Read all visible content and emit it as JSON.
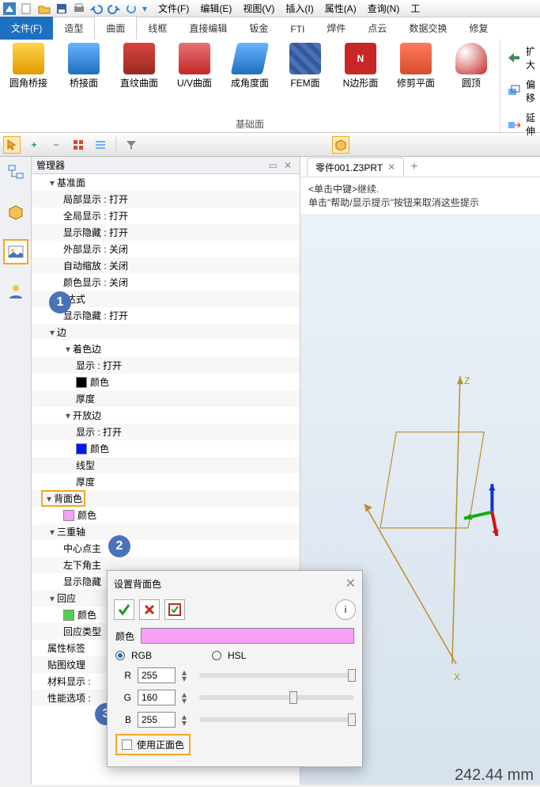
{
  "menus": {
    "file": "文件(F)",
    "edit": "编辑(E)",
    "view": "视图(V)",
    "insert": "插入(I)",
    "attr": "属性(A)",
    "query": "查询(N)",
    "tool": "工"
  },
  "ribbon": {
    "tabs": {
      "file": "文件(F)",
      "model": "造型",
      "curve": "曲面",
      "wire": "线框",
      "direct": "直接编辑",
      "sheet": "钣金",
      "fti": "FTI",
      "weld": "焊件",
      "pcloud": "点云",
      "dataex": "数据交换",
      "repair": "修复"
    },
    "items": {
      "yuanjiao": "圆角桥接",
      "qiaojie": "桥接面",
      "zhiwen": "直纹曲面",
      "uv": "U/V曲面",
      "chengjiao": "成角度面",
      "fem": "FEM面",
      "nbian": "N边形面",
      "xiujian": "修剪平面",
      "yuanding": "圆顶"
    },
    "group": "基础面",
    "right": {
      "expand": "扩大",
      "offset": "偏移",
      "extend": "延伸"
    }
  },
  "manager": {
    "title": "管理器",
    "nodes": {
      "jizhun": "基准面",
      "jubu": "局部显示 : 打开",
      "quanju": "全局显示 : 打开",
      "xsyin": "显示隐藏 : 打开",
      "waibu": "外部显示 : 关闭",
      "zdsf": "自动缩放 : 关闭",
      "ysxs": "颜色显示 : 关闭",
      "biaodashi": "表达式",
      "xsyin2": "显示隐藏 : 打开",
      "bian": "边",
      "zhuose": "着色边",
      "xianshi1": "显示 : 打开",
      "yanse1": "颜色",
      "houdu1": "厚度",
      "kaifang": "开放边",
      "xianshi2": "显示 : 打开",
      "yanse2": "颜色",
      "xianxing": "线型",
      "houdu2": "厚度",
      "beimian": "背面色",
      "yanse3": "颜色",
      "sanzhong": "三重轴",
      "zhongxin": "中心点主",
      "zuoxia": "左下角主",
      "xsyin3": "显示隐藏",
      "huiying": "回应",
      "yanse4": "颜色",
      "hyleixing": "回应类型",
      "shuxing": "属性标签",
      "tietu": "贴图纹理",
      "cailiao": "材料显示 :",
      "xingneng": "性能选项 :"
    }
  },
  "viewport": {
    "tab": "零件001.Z3PRT",
    "hint1": "<单击中键>继续.",
    "hint2": "单击\"帮助/显示提示\"按钮来取消这些提示",
    "axisZ": "Z",
    "axisX": "X",
    "measure": "242.44 mm"
  },
  "dialog": {
    "title": "设置背面色",
    "color_label": "颜色",
    "rgb": "RGB",
    "hsl": "HSL",
    "r": "R",
    "g": "G",
    "b": "B",
    "rv": "255",
    "gv": "160",
    "bv": "255",
    "use_front": "使用正面色",
    "preview_color": "#f8a0f8"
  },
  "callouts": {
    "c1": "1",
    "c2": "2",
    "c3": "3"
  }
}
